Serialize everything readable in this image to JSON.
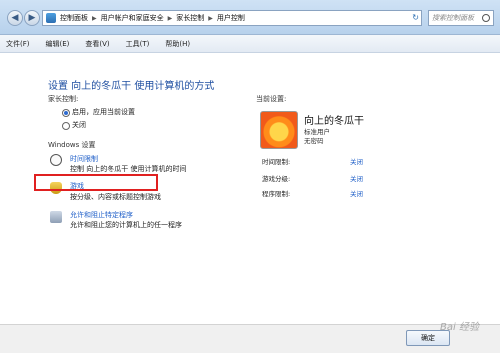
{
  "window": {
    "title": "控制面板 用户帐户和家庭安全 家长控制 用户控制",
    "breadcrumb": [
      "控制面板",
      "用户帐户和家庭安全",
      "家长控制",
      "用户控制"
    ],
    "search_placeholder": "搜索控制面板"
  },
  "menubar": {
    "items": [
      "文件(F)",
      "编辑(E)",
      "查看(V)",
      "工具(T)",
      "帮助(H)"
    ]
  },
  "main": {
    "title": "设置 向上的冬瓜干 使用计算机的方式",
    "parental_control_label": "家长控制:",
    "radio_on": "启用，应用当前设置",
    "radio_off": "关闭",
    "windows_settings_label": "Windows 设置",
    "time_limits_link": "时间限制",
    "time_limits_desc": "控制 向上的冬瓜干 使用计算机的时间",
    "games_link": "游戏",
    "games_desc": "按分级、内容或标题控制游戏",
    "programs_link": "允许和阻止特定程序",
    "programs_desc": "允许和阻止您的计算机上的任一程序"
  },
  "current_settings": {
    "label": "当前设置:",
    "user_name": "向上的冬瓜干",
    "user_type": "标准用户",
    "user_password": "无密码",
    "time_limits_label": "时间限制:",
    "time_limits_value": "关闭",
    "game_rating_label": "游戏分级:",
    "game_rating_value": "关闭",
    "program_limits_label": "程序限制:",
    "program_limits_value": "关闭"
  },
  "footer": {
    "ok_label": "确定"
  },
  "watermark": "Bai 经验"
}
